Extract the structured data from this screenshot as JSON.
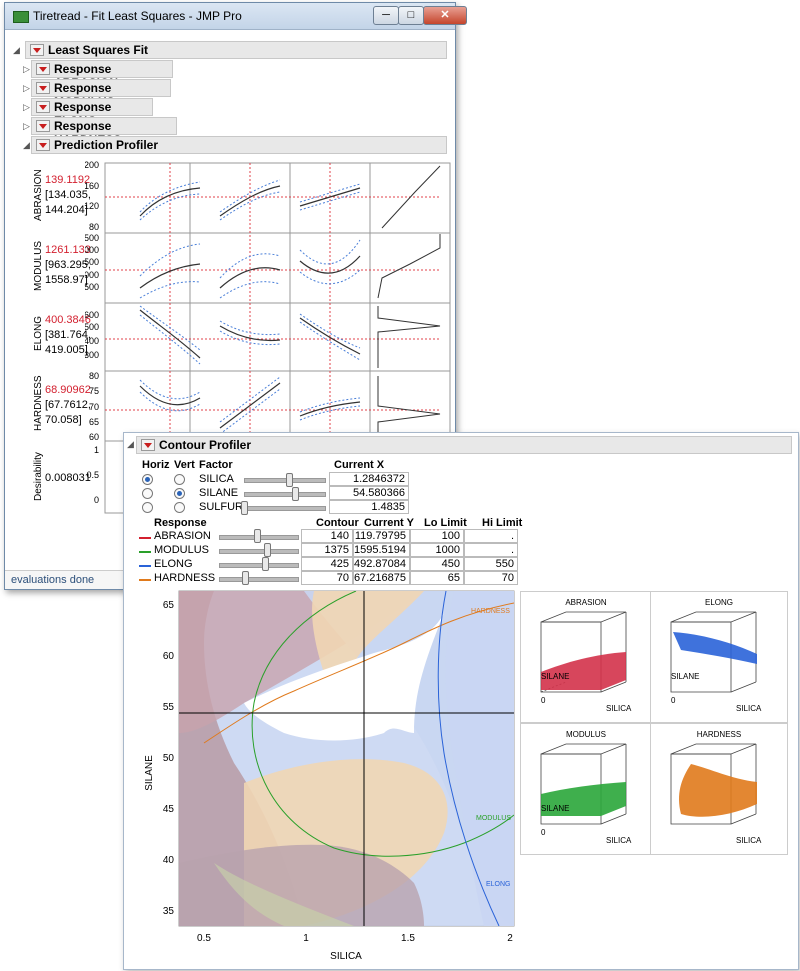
{
  "main_window": {
    "title": "Tiretread - Fit Least Squares - JMP Pro",
    "buttons": {
      "minimize": "─",
      "maximize": "□",
      "close": "✕"
    },
    "outlines": [
      {
        "label": "Least Squares Fit"
      },
      {
        "label": "Response ABRASION"
      },
      {
        "label": "Response MODULUS"
      },
      {
        "label": "Response ELONG"
      },
      {
        "label": "Response HARDNESS"
      },
      {
        "label": "Prediction Profiler"
      }
    ],
    "status": "evaluations done"
  },
  "profiler": {
    "rows": [
      {
        "name": "ABRASION",
        "value": "139.1192",
        "ci_lo": "[134.035,",
        "ci_hi": "144.204]",
        "ticks": [
          "200",
          "160",
          "120",
          "80"
        ]
      },
      {
        "name": "MODULUS",
        "value": "1261.133",
        "ci_lo": "[963.295,",
        "ci_hi": "1558.97]",
        "ticks": [
          "2500",
          "2000",
          "1500",
          "1000",
          "500"
        ]
      },
      {
        "name": "ELONG",
        "value": "400.3846",
        "ci_lo": "[381.764,",
        "ci_hi": "419.005]",
        "ticks": [
          "600",
          "500",
          "400",
          "300"
        ]
      },
      {
        "name": "HARDNESS",
        "value": "68.90962",
        "ci_lo": "[67.7612,",
        "ci_hi": "70.058]",
        "ticks": [
          "80",
          "75",
          "70",
          "65",
          "60"
        ]
      }
    ],
    "desirability_label": "Desirability",
    "desirability_value": "0.008031",
    "desirability_ticks": [
      "1",
      "0.5",
      "0"
    ]
  },
  "contour": {
    "title": "Contour Profiler",
    "factor_headers": {
      "horiz": "Horiz",
      "vert": "Vert",
      "factor": "Factor",
      "current": "Current X"
    },
    "factors": [
      {
        "name": "SILICA",
        "value": "1.2846372",
        "horiz": true,
        "vert": false
      },
      {
        "name": "SILANE",
        "value": "54.580366",
        "horiz": false,
        "vert": true
      },
      {
        "name": "SULFUR",
        "value": "1.4835",
        "horiz": false,
        "vert": false
      }
    ],
    "response_headers": {
      "response": "Response",
      "contour": "Contour",
      "current": "Current Y",
      "lo": "Lo Limit",
      "hi": "Hi Limit"
    },
    "responses": [
      {
        "name": "ABRASION",
        "color": "#d3202f",
        "contour": "140",
        "current": "119.79795",
        "lo": "100",
        "hi": "."
      },
      {
        "name": "MODULUS",
        "color": "#2aa02a",
        "contour": "1375",
        "current": "1595.5194",
        "lo": "1000",
        "hi": "."
      },
      {
        "name": "ELONG",
        "color": "#2a63d8",
        "contour": "425",
        "current": "492.87084",
        "lo": "450",
        "hi": "550"
      },
      {
        "name": "HARDNESS",
        "color": "#e07a1c",
        "contour": "70",
        "current": "67.216875",
        "lo": "65",
        "hi": "70"
      }
    ],
    "plot": {
      "xlabel": "SILICA",
      "ylabel": "SILANE",
      "xticks": [
        "0.5",
        "1",
        "1.5",
        "2"
      ],
      "yticks": [
        "65",
        "60",
        "55",
        "50",
        "45",
        "40",
        "35"
      ],
      "curve_labels": [
        "HARDNESS",
        "MODULUS",
        "ELONG"
      ]
    },
    "surfaces": [
      {
        "title": "ABRASION",
        "color": "#d3324a"
      },
      {
        "title": "ELONG",
        "color": "#2a63d8"
      },
      {
        "title": "MODULUS",
        "color": "#2aa63a"
      },
      {
        "title": "HARDNESS",
        "color": "#e07a1c"
      }
    ],
    "surface_axes": {
      "x": "SILICA",
      "y": "SILANE",
      "zero": "0"
    }
  }
}
